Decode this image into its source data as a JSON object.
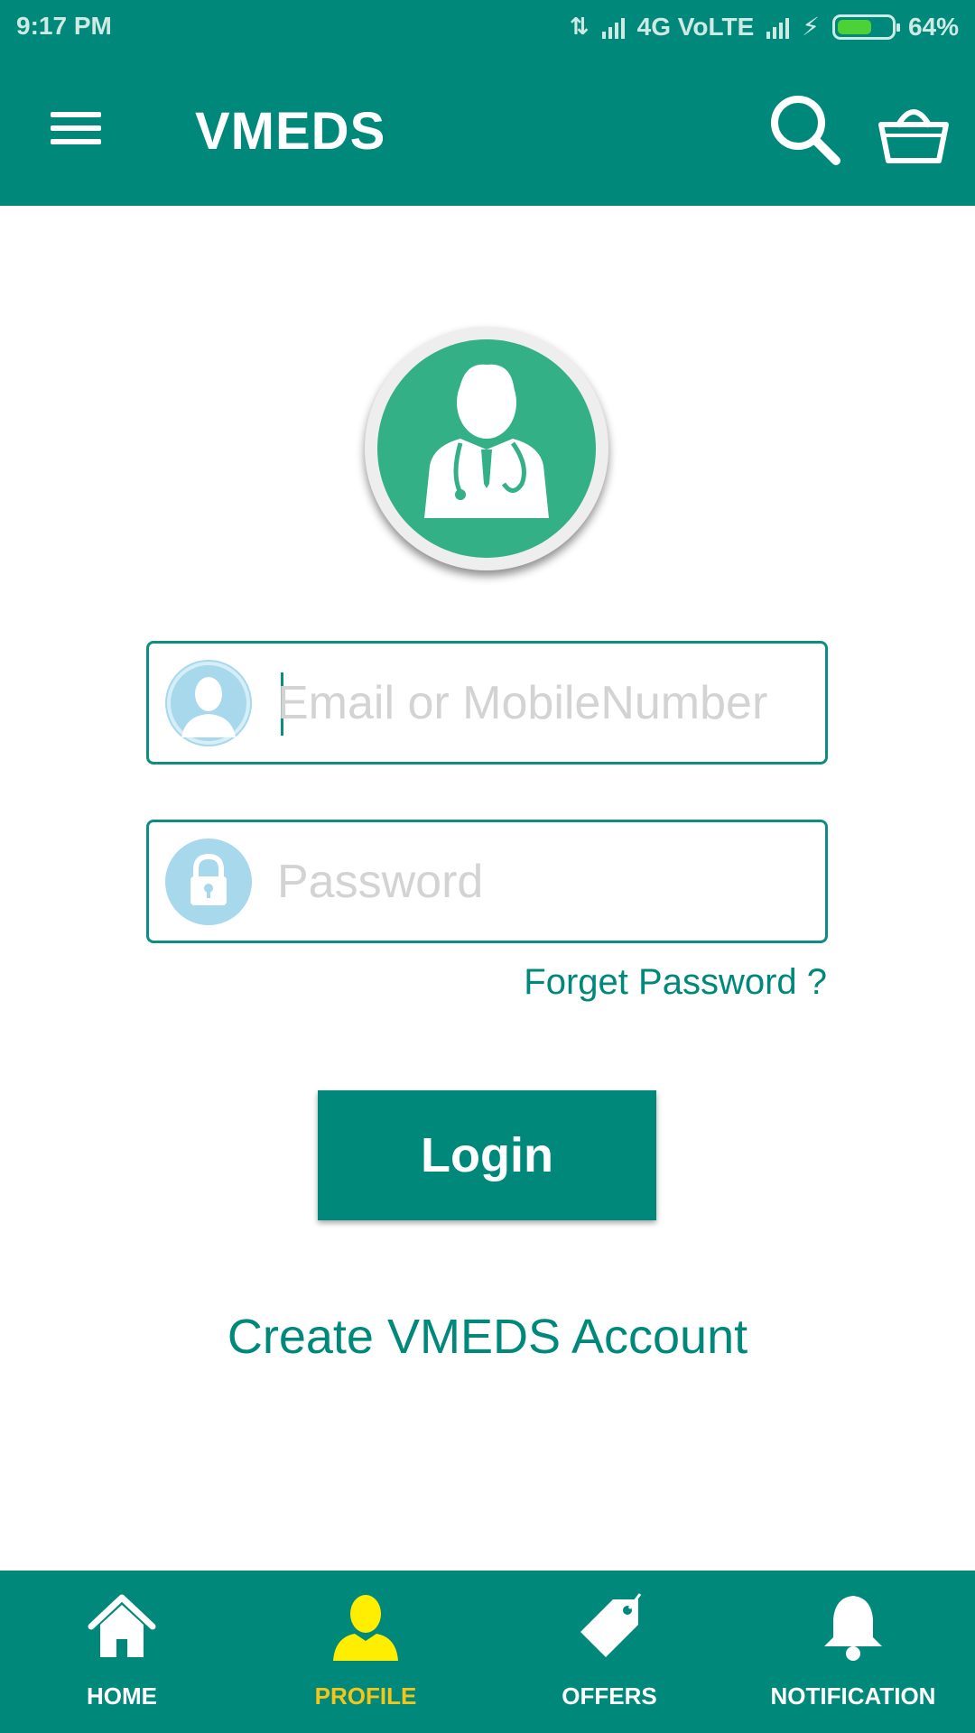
{
  "status_bar": {
    "time": "9:17 PM",
    "network": "4G VoLTE",
    "battery_percent": "64%",
    "battery_level": 0.64
  },
  "app_bar": {
    "title": "VMEDS",
    "icons": [
      "menu-icon",
      "search-icon",
      "cart-icon"
    ]
  },
  "avatar": {
    "icon": "doctor-icon"
  },
  "login_form": {
    "email_placeholder": "Email or MobileNumber",
    "email_value": "",
    "password_placeholder": "Password",
    "password_value": "",
    "forgot_password": "Forget Password ?",
    "login_button": "Login",
    "create_account": "Create VMEDS Account"
  },
  "bottom_nav": {
    "items": [
      {
        "label": "HOME",
        "icon": "home-icon"
      },
      {
        "label": "PROFILE",
        "icon": "profile-icon"
      },
      {
        "label": "OFFERS",
        "icon": "offers-tag-icon"
      },
      {
        "label": "NOTIFICATION",
        "icon": "bell-icon"
      }
    ],
    "active_index": 1
  },
  "colors": {
    "primary": "#00897b",
    "avatar_green": "#33b085",
    "active_nav": "#f5c518",
    "field_icon_bg": "#a7d8ec",
    "battery_fill": "#4cd137"
  }
}
